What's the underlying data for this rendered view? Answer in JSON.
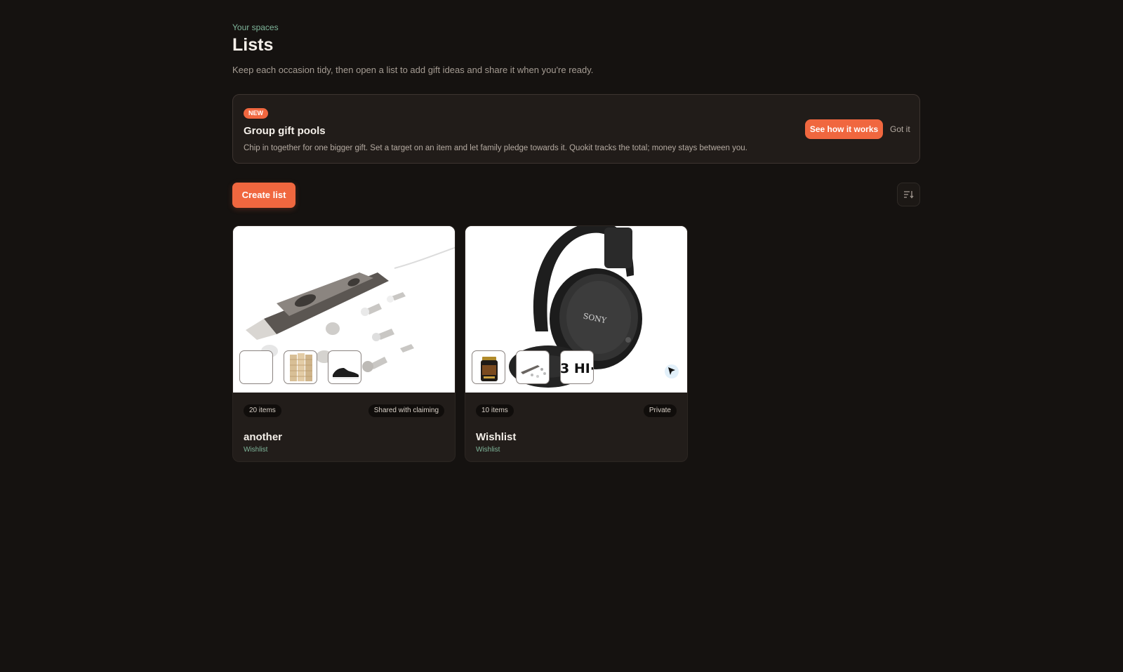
{
  "header": {
    "eyebrow": "Your spaces",
    "title": "Lists",
    "subtitle": "Keep each occasion tidy, then open a list to add gift ideas and share it when you're ready."
  },
  "banner": {
    "badge": "NEW",
    "title": "Group gift pools",
    "description": "Chip in together for one bigger gift. Set a target on an item and let family pledge towards it. Quokit tracks the total; money stays between you.",
    "primary_label": "See how it works",
    "dismiss_label": "Got it"
  },
  "toolbar": {
    "create_label": "Create list",
    "sort_icon": "sort-icon"
  },
  "lists": [
    {
      "count": "20 items",
      "sharing": "Shared with claiming",
      "name": "another",
      "type": "Wishlist",
      "cover": "nail-drill-kit-image",
      "thumbs": [
        "blank-thumbnail",
        "room-divider-thumbnail",
        "sneaker-thumbnail"
      ]
    },
    {
      "count": "10 items",
      "sharing": "Private",
      "name": "Wishlist",
      "type": "Wishlist",
      "cover": "sony-headphones-image",
      "thumbs": [
        "supplement-jar-thumbnail",
        "nail-drill-thumbnail",
        "logo-thumbnail"
      ],
      "cover_brand": "SONY",
      "thumb_logo_text": "3 HI·"
    }
  ],
  "colors": {
    "background": "#151210",
    "accent": "#f0673f",
    "muted_green": "#7fb59a",
    "card": "#221d1a"
  }
}
